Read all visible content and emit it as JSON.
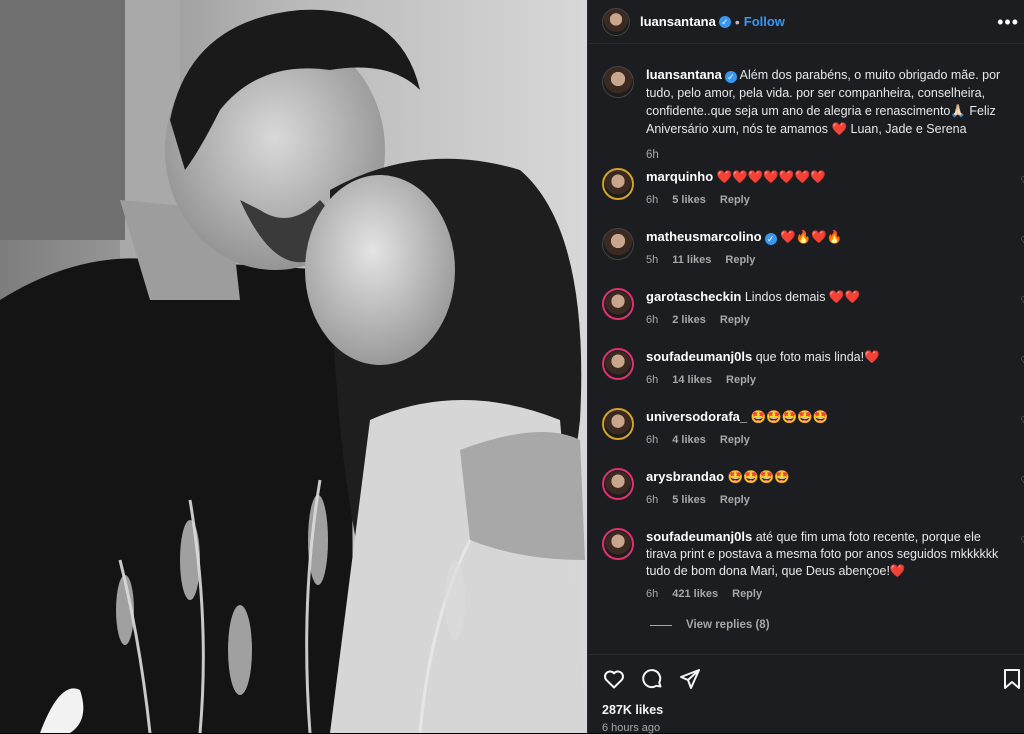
{
  "post": {
    "username": "luansantana",
    "verified_mark": "✓",
    "dot": "•",
    "follow_label": "Follow",
    "more_label": "•••"
  },
  "caption": {
    "username": "luansantana",
    "text": "Além dos parabéns, o muito obrigado mãe. por tudo, pelo amor, pela vida. por ser companheira, conselheira, confidente..que seja um ano de alegria e renascimento🙏🏻 Feliz Aniversário xum, nós te amamos ❤️ Luan, Jade e Serena",
    "time": "6h"
  },
  "comments": [
    {
      "username": "marquinho",
      "verified": false,
      "text": "❤️❤️❤️❤️❤️❤️❤️",
      "time": "6h",
      "likes": "5 likes",
      "reply": "Reply"
    },
    {
      "username": "matheusmarcolino",
      "verified": true,
      "text": "❤️🔥❤️🔥",
      "time": "5h",
      "likes": "11 likes",
      "reply": "Reply"
    },
    {
      "username": "garotascheckin",
      "verified": false,
      "text": "Lindos demais ❤️❤️",
      "time": "6h",
      "likes": "2 likes",
      "reply": "Reply"
    },
    {
      "username": "soufadeumanj0ls",
      "verified": false,
      "text": "que foto mais linda!❤️",
      "time": "6h",
      "likes": "14 likes",
      "reply": "Reply"
    },
    {
      "username": "universodorafa_",
      "verified": false,
      "text": "🤩🤩🤩🤩🤩",
      "time": "6h",
      "likes": "4 likes",
      "reply": "Reply"
    },
    {
      "username": "arysbrandao",
      "verified": false,
      "text": "🤩🤩🤩🤩",
      "time": "6h",
      "likes": "5 likes",
      "reply": "Reply"
    },
    {
      "username": "soufadeumanj0ls",
      "verified": false,
      "text": "até que fim uma foto recente, porque ele tirava print e postava a mesma foto por anos seguidos mkkkkkk tudo de bom dona Mari, que Deus abençoe!❤️",
      "time": "6h",
      "likes": "421 likes",
      "reply": "Reply"
    }
  ],
  "view_replies": "View replies (8)",
  "footer": {
    "likes": "287K likes",
    "time": "6 hours ago"
  },
  "icons": {
    "heart": "heart-icon",
    "comment": "comment-icon",
    "share": "share-icon",
    "save": "bookmark-icon",
    "more": "more-icon"
  },
  "colors": {
    "panel_bg": "#1b1d21",
    "link_blue": "#3897f0",
    "verified_blue": "#3897f0",
    "muted": "#a8a8a8"
  }
}
